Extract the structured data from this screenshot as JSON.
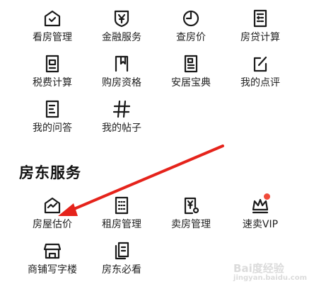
{
  "tools": {
    "items": [
      {
        "label": "看房管理",
        "icon": "house-shield-icon"
      },
      {
        "label": "金融服务",
        "icon": "yuan-shield-icon"
      },
      {
        "label": "查房价",
        "icon": "clock-price-icon"
      },
      {
        "label": "房贷计算",
        "icon": "calculator-icon"
      },
      {
        "label": "税费计算",
        "icon": "tax-doc-icon"
      },
      {
        "label": "购房资格",
        "icon": "bookmark-doc-icon"
      },
      {
        "label": "安居宝典",
        "icon": "guide-book-icon"
      },
      {
        "label": "我的点评",
        "icon": "edit-review-icon"
      },
      {
        "label": "我的问答",
        "icon": "qa-doc-icon"
      },
      {
        "label": "我的帖子",
        "icon": "hashtag-icon"
      }
    ]
  },
  "landlord": {
    "title": "房东服务",
    "items": [
      {
        "label": "房屋估价",
        "icon": "house-trend-icon"
      },
      {
        "label": "租房管理",
        "icon": "building-icon"
      },
      {
        "label": "卖房管理",
        "icon": "sale-doc-icon"
      },
      {
        "label": "速卖VIP",
        "icon": "crown-icon",
        "badge": "red-dot"
      },
      {
        "label": "商铺写字楼",
        "icon": "shop-icon"
      },
      {
        "label": "房东必看",
        "icon": "pages-icon"
      }
    ]
  },
  "annotation": {
    "color": "#e5231b"
  },
  "watermark": {
    "text": "Bai度经验",
    "sub": "jingyan.baidu.com"
  }
}
